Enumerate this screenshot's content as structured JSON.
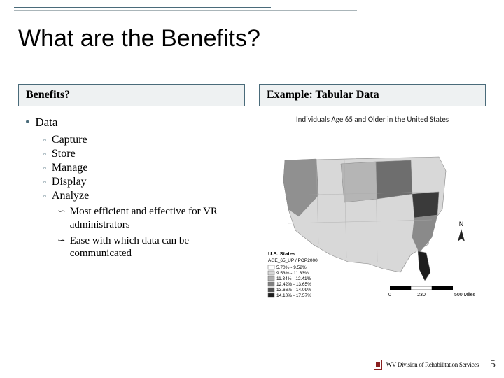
{
  "title": "What are the Benefits?",
  "left": {
    "header": "Benefits?",
    "l1": "Data",
    "items": [
      "Capture",
      "Store",
      "Manage",
      "Display",
      "Analyze"
    ],
    "sub": [
      "Most efficient and effective for VR administrators",
      "Ease with which data can be communicated"
    ]
  },
  "right": {
    "header": "Example: Tabular Data",
    "map_title": "Individuals Age 65 and Older in the United States",
    "legend_heading": "U.S. States",
    "legend_field": "AGE_65_UP / POP2000",
    "legend": [
      "5.70% - 9.52%",
      "9.53% - 11.33%",
      "11.34% - 12.41%",
      "12.42% - 13.65%",
      "13.66% - 14.09%",
      "14.10% - 17.57%"
    ],
    "scale_left": "0",
    "scale_mid": "230",
    "scale_right": "500 Miles",
    "compass": "N"
  },
  "footer": {
    "org": "WV Division of Rehabilitation Services",
    "page": "5"
  }
}
